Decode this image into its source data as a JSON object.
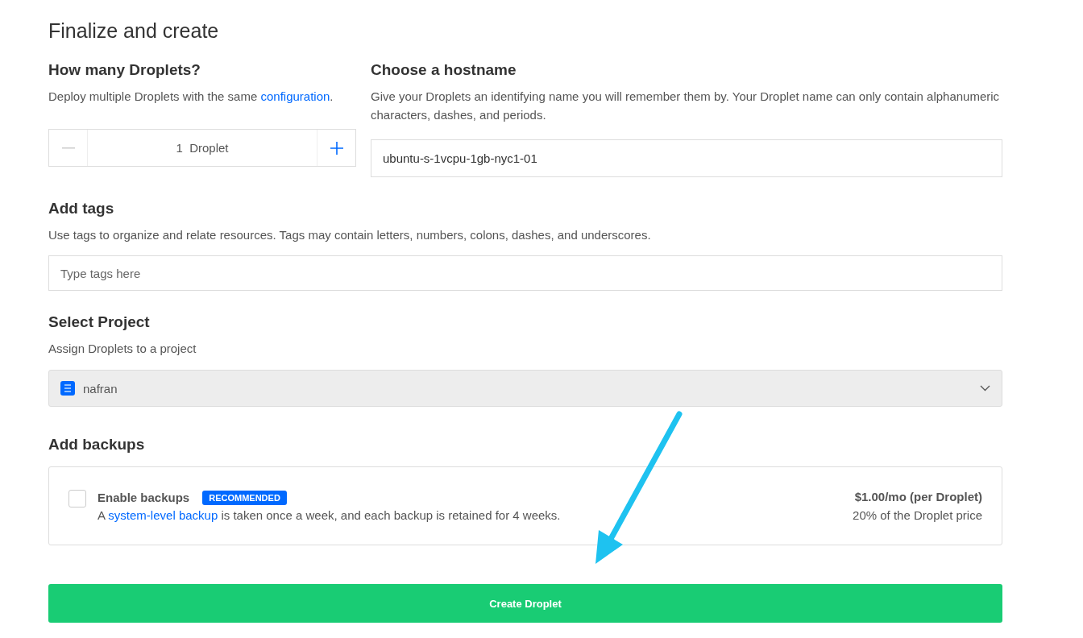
{
  "title": "Finalize and create",
  "droplet_count": {
    "heading": "How many Droplets?",
    "description": {
      "before": "Deploy multiple Droplets with the same ",
      "link": "configuration",
      "after": "."
    },
    "value": "1  Droplet",
    "decrement_disabled": true
  },
  "hostname": {
    "heading": "Choose a hostname",
    "description": "Give your Droplets an identifying name you will remember them by. Your Droplet name can only contain alphanumeric characters, dashes, and periods.",
    "value": "ubuntu-s-1vcpu-1gb-nyc1-01"
  },
  "tags": {
    "heading": "Add tags",
    "description": "Use tags to organize and relate resources. Tags may contain letters, numbers, colons, dashes, and underscores.",
    "placeholder": "Type tags here"
  },
  "project": {
    "heading": "Select Project",
    "description": "Assign Droplets to a project",
    "value": "nafran"
  },
  "backups": {
    "heading": "Add backups",
    "label": "Enable backups",
    "checked": false,
    "badge": "RECOMMENDED",
    "description": {
      "before": "A ",
      "link": "system-level backup",
      "after": " is taken once a week, and each backup is retained for 4 weeks."
    },
    "price": "$1.00/mo (per Droplet)",
    "price_note": "20% of the Droplet price"
  },
  "create_button": "Create Droplet"
}
